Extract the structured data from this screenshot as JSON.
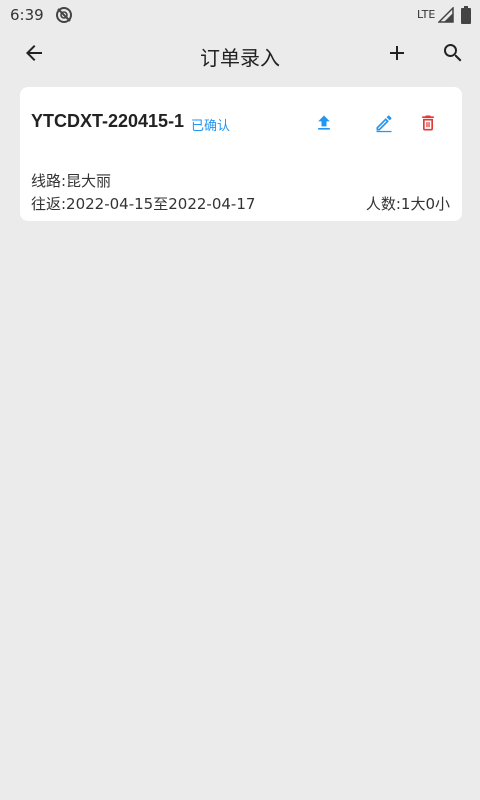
{
  "status_bar": {
    "time": "6:39",
    "network": "LTE",
    "notification_icon": "sync-off-icon",
    "signal_icon": "signal-icon",
    "battery_icon": "battery-icon"
  },
  "app_bar": {
    "title": "订单录入",
    "back_icon": "arrow-left-icon",
    "add_icon": "plus-icon",
    "search_icon": "search-icon"
  },
  "orders": [
    {
      "order_no": "YTCDXT-220415-1",
      "status": "已确认",
      "route_label": "线路:",
      "route": "昆大丽",
      "route_text": "线路:昆大丽",
      "dates_text": "往返:2022-04-15至2022-04-17",
      "people_text": "人数:1大0小",
      "actions": [
        "upload-icon",
        "edit-icon",
        "delete-icon"
      ]
    }
  ],
  "colors": {
    "background": "#ebebeb",
    "card": "#ffffff",
    "accent": "#2196f3",
    "danger": "#e53935"
  }
}
